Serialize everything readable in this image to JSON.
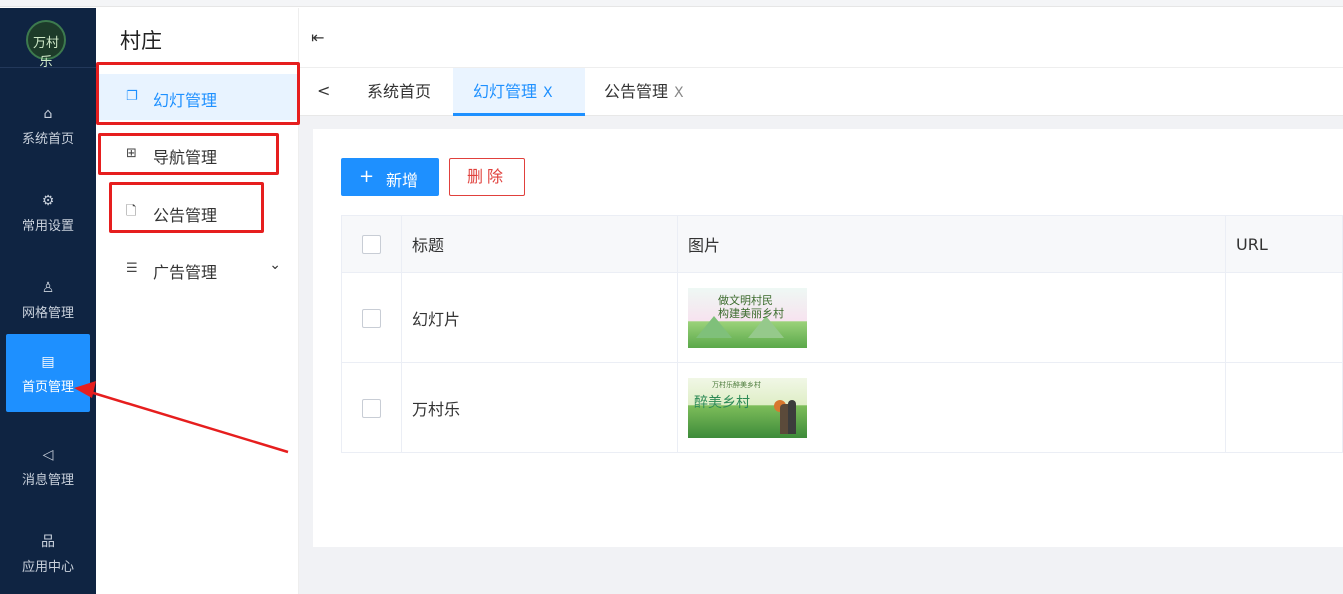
{
  "rail": {
    "logo_text": "万村乐",
    "items": [
      {
        "label": "系统首页",
        "icon": "home-icon",
        "glyph": "⌂"
      },
      {
        "label": "常用设置",
        "icon": "gear-icon",
        "glyph": "⚙"
      },
      {
        "label": "网格管理",
        "icon": "user-icon",
        "glyph": "♙"
      },
      {
        "label": "首页管理",
        "icon": "page-icon",
        "glyph": "▤"
      },
      {
        "label": "消息管理",
        "icon": "speaker-icon",
        "glyph": "◁"
      },
      {
        "label": "应用中心",
        "icon": "sitemap-icon",
        "glyph": "品"
      }
    ]
  },
  "sub": {
    "title": "村庄",
    "items": [
      {
        "label": "幻灯管理",
        "icon": "copy-icon",
        "glyph": "❐"
      },
      {
        "label": "导航管理",
        "icon": "grid-icon",
        "glyph": "⊞"
      },
      {
        "label": "公告管理",
        "icon": "document-icon",
        "glyph": "🗋"
      },
      {
        "label": "广告管理",
        "icon": "list-icon",
        "glyph": "☰",
        "chevron": "⌄"
      }
    ]
  },
  "header": {
    "toggle_glyph": "⇤"
  },
  "tabs": {
    "back_glyph": "<",
    "items": [
      {
        "label": "系统首页"
      },
      {
        "label": "幻灯管理",
        "close": "X"
      },
      {
        "label": "公告管理",
        "close": "X"
      }
    ]
  },
  "toolbar": {
    "add_label": "新增",
    "add_glyph": "+",
    "delete_label": "删除"
  },
  "table": {
    "headers": [
      "标题",
      "图片",
      "URL"
    ],
    "rows": [
      {
        "title": "幻灯片",
        "image_text": "做文明村民\n构建美丽乡村"
      },
      {
        "title": "万村乐",
        "image_text": "醉美乡村",
        "image_subtext": "万村乐醉美乡村"
      }
    ]
  },
  "colors": {
    "rail_bg": "#0f2442",
    "accent": "#1e90ff",
    "danger": "#e0403c",
    "annotation": "#e61e1e"
  }
}
